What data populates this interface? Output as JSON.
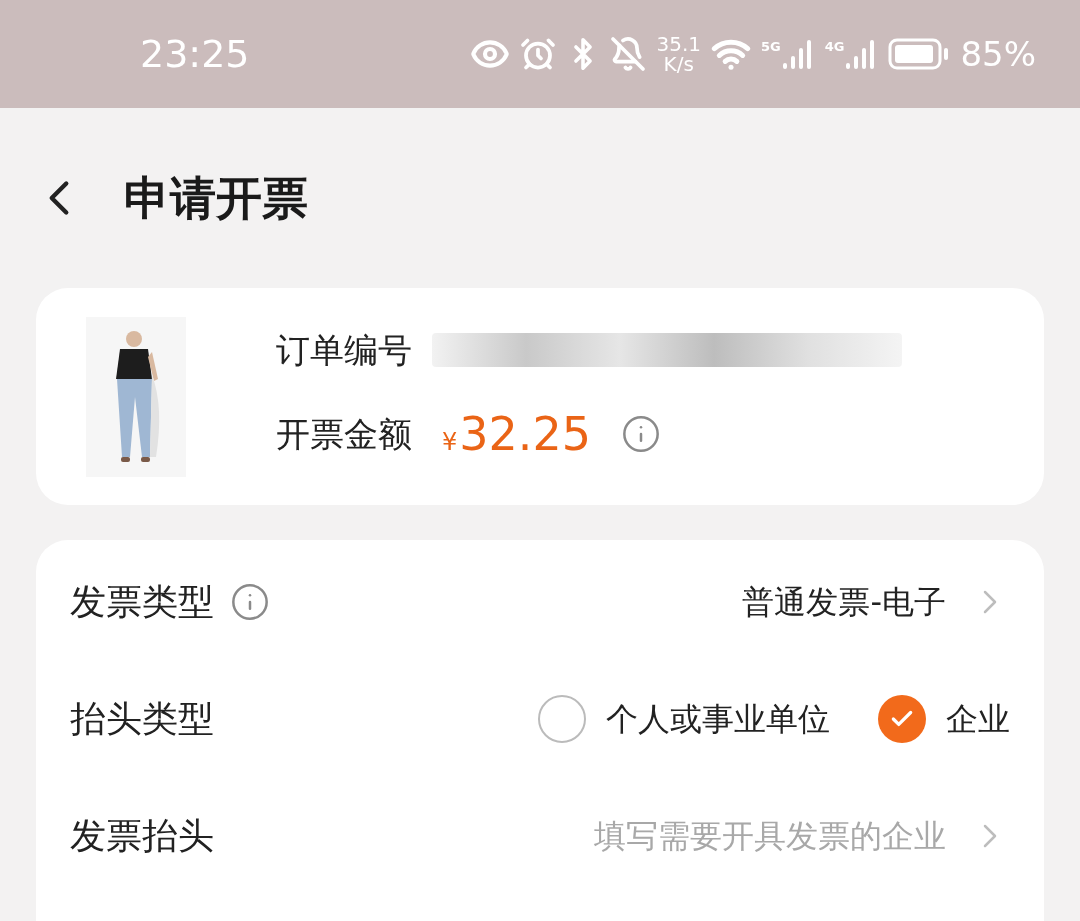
{
  "status_bar": {
    "time": "23:25",
    "speed_value": "35.1",
    "speed_unit": "K/s",
    "network_1": "5G",
    "network_2": "4G",
    "battery": "85%"
  },
  "header": {
    "title": "申请开票"
  },
  "order": {
    "kind": "picture",
    "number_label": "订单编号",
    "amount_label": "开票金额",
    "currency": "¥",
    "amount": "32.25"
  },
  "form": [
    {
      "kind": "select",
      "label": "发票类型",
      "info": true,
      "value": "普通发票-电子"
    },
    {
      "kind": "radio",
      "label": "抬头类型",
      "info": false,
      "options": [
        {
          "label": "个人或事业单位",
          "selected": false
        },
        {
          "label": "企业",
          "selected": true
        }
      ]
    },
    {
      "kind": "input",
      "label": "发票抬头",
      "info": false,
      "placeholder": "填写需要开具发票的企业"
    }
  ]
}
